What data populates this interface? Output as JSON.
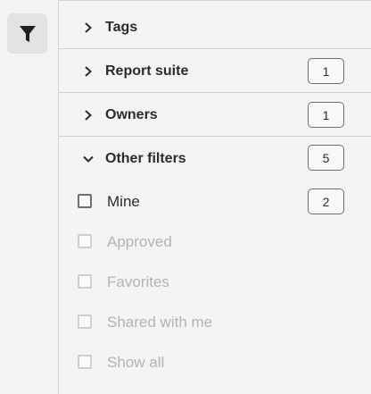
{
  "toolbar": {
    "filter_icon": "filter-icon"
  },
  "sections": [
    {
      "label": "Tags",
      "expanded": false,
      "count": null
    },
    {
      "label": "Report suite",
      "expanded": false,
      "count": "1"
    },
    {
      "label": "Owners",
      "expanded": false,
      "count": "1"
    },
    {
      "label": "Other filters",
      "expanded": true,
      "count": "5"
    }
  ],
  "other_filters": [
    {
      "label": "Mine",
      "count": "2",
      "enabled": true,
      "checked": false
    },
    {
      "label": "Approved",
      "enabled": false,
      "checked": false
    },
    {
      "label": "Favorites",
      "enabled": false,
      "checked": false
    },
    {
      "label": "Shared with me",
      "enabled": false,
      "checked": false
    },
    {
      "label": "Show all",
      "enabled": false,
      "checked": false
    }
  ]
}
